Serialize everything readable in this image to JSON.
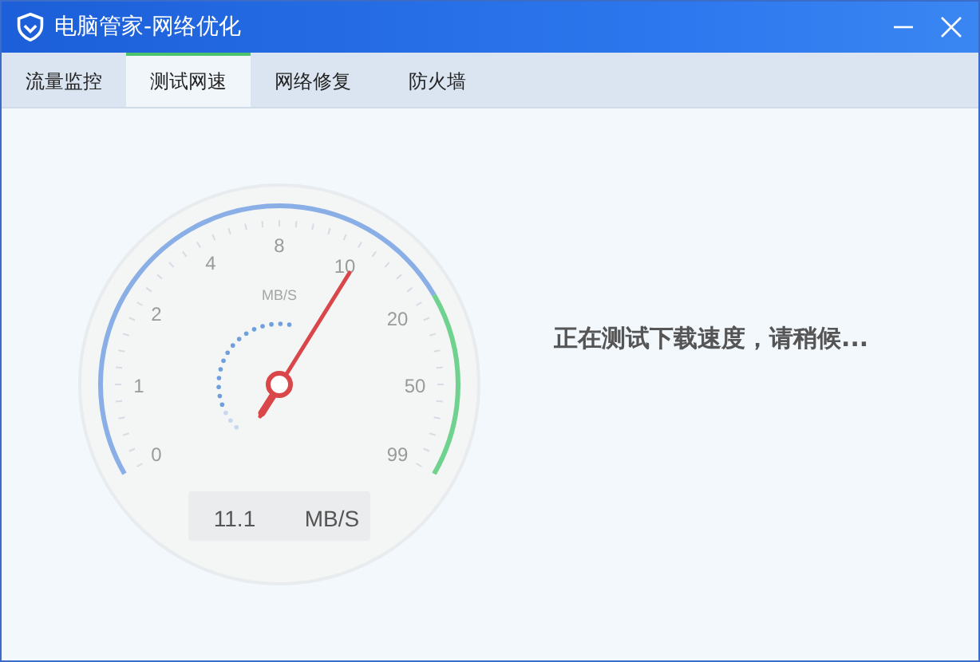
{
  "window": {
    "title": "电脑管家-网络优化"
  },
  "tabs": [
    {
      "label": "流量监控",
      "selected": false
    },
    {
      "label": "测试网速",
      "selected": true
    },
    {
      "label": "网络修复",
      "selected": false
    },
    {
      "label": "防火墙",
      "selected": false
    }
  ],
  "gauge": {
    "unit_label": "MB/S",
    "ticks": [
      "0",
      "1",
      "2",
      "4",
      "8",
      "10",
      "20",
      "50",
      "99"
    ],
    "reading": {
      "value": "11.1",
      "unit": "MB/S"
    }
  },
  "status_text": "正在测试下载速度，请稍候..."
}
